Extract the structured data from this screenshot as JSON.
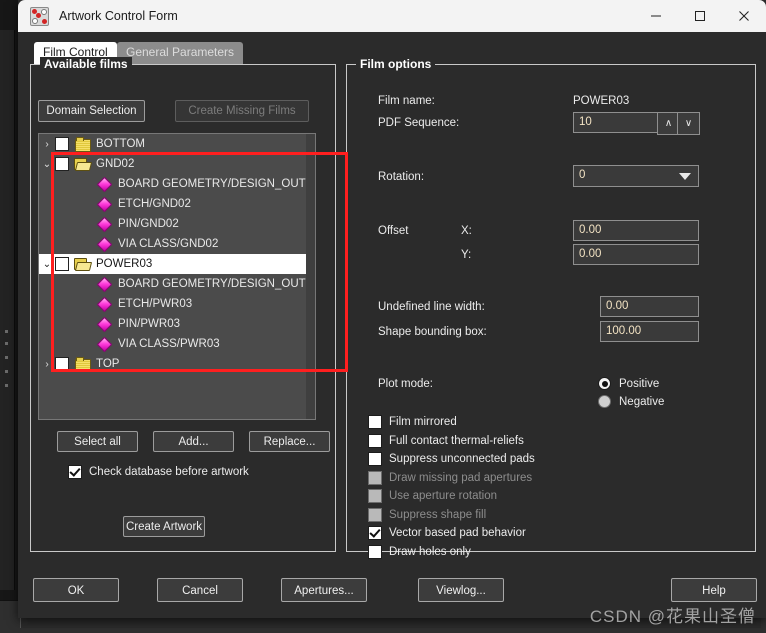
{
  "window": {
    "title": "Artwork Control Form",
    "app_icon": "artwork-app-icon",
    "minimize": "—",
    "maximize": "□",
    "close": "✕"
  },
  "tabs": [
    {
      "label": "Film Control",
      "active": true
    },
    {
      "label": "General Parameters",
      "active": false
    }
  ],
  "available_films": {
    "legend": "Available films",
    "domain_selection_label": "Domain Selection",
    "create_missing_films_label": "Create Missing Films",
    "tree": [
      {
        "label": "BOTTOM",
        "level": 0,
        "twisty": "›",
        "icon": "folder-closed-icon",
        "checkbox": true,
        "checked": false,
        "selected": false
      },
      {
        "label": "GND02",
        "level": 0,
        "twisty": "⌄",
        "icon": "folder-open-icon",
        "checkbox": true,
        "checked": false,
        "selected": false
      },
      {
        "label": "BOARD GEOMETRY/DESIGN_OUTLINE",
        "level": 1,
        "twisty": "",
        "icon": "layer-diamond-icon",
        "checkbox": false,
        "checked": false,
        "selected": false
      },
      {
        "label": "ETCH/GND02",
        "level": 1,
        "twisty": "",
        "icon": "layer-diamond-icon",
        "checkbox": false,
        "checked": false,
        "selected": false
      },
      {
        "label": "PIN/GND02",
        "level": 1,
        "twisty": "",
        "icon": "layer-diamond-icon",
        "checkbox": false,
        "checked": false,
        "selected": false
      },
      {
        "label": "VIA CLASS/GND02",
        "level": 1,
        "twisty": "",
        "icon": "layer-diamond-icon",
        "checkbox": false,
        "checked": false,
        "selected": false
      },
      {
        "label": "POWER03",
        "level": 0,
        "twisty": "⌄",
        "icon": "folder-open-icon",
        "checkbox": true,
        "checked": false,
        "selected": true
      },
      {
        "label": "BOARD GEOMETRY/DESIGN_OUTLINE",
        "level": 1,
        "twisty": "",
        "icon": "layer-diamond-icon",
        "checkbox": false,
        "checked": false,
        "selected": false
      },
      {
        "label": "ETCH/PWR03",
        "level": 1,
        "twisty": "",
        "icon": "layer-diamond-icon",
        "checkbox": false,
        "checked": false,
        "selected": false
      },
      {
        "label": "PIN/PWR03",
        "level": 1,
        "twisty": "",
        "icon": "layer-diamond-icon",
        "checkbox": false,
        "checked": false,
        "selected": false
      },
      {
        "label": "VIA CLASS/PWR03",
        "level": 1,
        "twisty": "",
        "icon": "layer-diamond-icon",
        "checkbox": false,
        "checked": false,
        "selected": false
      },
      {
        "label": "TOP",
        "level": 0,
        "twisty": "›",
        "icon": "folder-closed-icon",
        "checkbox": true,
        "checked": false,
        "selected": false
      }
    ],
    "select_all_label": "Select all",
    "add_label": "Add...",
    "replace_label": "Replace...",
    "check_database_label": "Check database before artwork",
    "check_database_checked": true,
    "create_artwork_label": "Create Artwork"
  },
  "film_options": {
    "legend": "Film options",
    "film_name_label": "Film name:",
    "film_name_value": "POWER03",
    "pdf_sequence_label": "PDF Sequence:",
    "pdf_sequence_value": "10",
    "spin_up": "∧",
    "spin_down": "∨",
    "rotation_label": "Rotation:",
    "rotation_value": "0",
    "offset_label": "Offset",
    "offset_x_label": "X:",
    "offset_x_value": "0.00",
    "offset_y_label": "Y:",
    "offset_y_value": "0.00",
    "undefined_line_width_label": "Undefined line width:",
    "undefined_line_width_value": "0.00",
    "shape_bounding_box_label": "Shape bounding box:",
    "shape_bounding_box_value": "100.00",
    "plot_mode_label": "Plot mode:",
    "plot_mode_options": [
      {
        "label": "Positive",
        "selected": true
      },
      {
        "label": "Negative",
        "selected": false
      }
    ],
    "checkboxes": [
      {
        "label": "Film mirrored",
        "checked": false,
        "disabled": false
      },
      {
        "label": "Full contact thermal-reliefs",
        "checked": false,
        "disabled": false
      },
      {
        "label": "Suppress unconnected pads",
        "checked": false,
        "disabled": false
      },
      {
        "label": "Draw missing pad apertures",
        "checked": false,
        "disabled": true
      },
      {
        "label": "Use aperture rotation",
        "checked": false,
        "disabled": true
      },
      {
        "label": "Suppress shape fill",
        "checked": false,
        "disabled": true
      },
      {
        "label": "Vector based pad behavior",
        "checked": true,
        "disabled": false
      },
      {
        "label": "Draw holes only",
        "checked": false,
        "disabled": false
      }
    ]
  },
  "footer": {
    "ok_label": "OK",
    "cancel_label": "Cancel",
    "apertures_label": "Apertures...",
    "viewlog_label": "Viewlog...",
    "help_label": "Help"
  },
  "watermark": "CSDN @花果山圣僧",
  "colors": {
    "dialog_bg": "#2b2b2b",
    "tree_bg": "#4b4b4b",
    "annotation_red": "#ff1f1f",
    "field_text": "#f3e3c4",
    "titlebar_bg": "#f3f3f3"
  }
}
